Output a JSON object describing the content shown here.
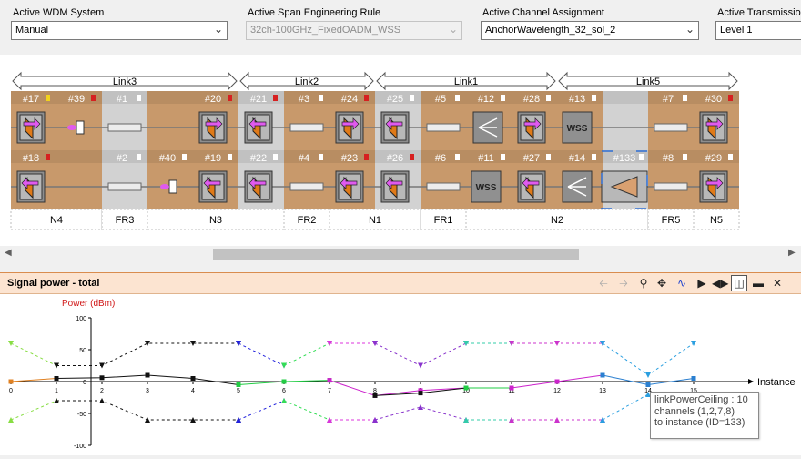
{
  "header": {
    "wdm_system": {
      "label": "Active WDM System",
      "value": "Manual"
    },
    "span_rule": {
      "label": "Active Span Engineering Rule",
      "value": "32ch-100GHz_FixedOADM_WSS"
    },
    "channel_assignment": {
      "label": "Active Channel Assignment",
      "value": "AnchorWavelength_32_sol_2"
    },
    "transmission": {
      "label": "Active Transmissio",
      "value": "Level 1"
    }
  },
  "diagram": {
    "links": [
      "Link3",
      "Link2",
      "Link1",
      "Link5"
    ],
    "row1_labels": [
      "#17",
      "#39",
      "#1",
      "#20",
      "#21",
      "#3",
      "#24",
      "#25",
      "#5",
      "#12",
      "#28",
      "#13",
      "#7",
      "#30"
    ],
    "row2_labels": [
      "#18",
      "#2",
      "#40",
      "#19",
      "#22",
      "#4",
      "#23",
      "#26",
      "#6",
      "#11",
      "#27",
      "#14",
      "#133",
      "#8",
      "#29"
    ],
    "wss_label": "WSS",
    "sites": [
      "N4",
      "FR3",
      "N3",
      "FR2",
      "N1",
      "FR1",
      "N2",
      "FR5",
      "N5"
    ],
    "colors": {
      "site": "#c8996b",
      "fiber": "#d2d2d2",
      "status_red": "#d62020",
      "status_yellow": "#f2d21c",
      "accent": "#e05aef",
      "select": "#2f6fd4"
    }
  },
  "panel": {
    "title": "Signal power - total",
    "tools": [
      "back-arrow",
      "forward-arrow",
      "zoom",
      "pan",
      "trend",
      "step",
      "fit",
      "dock",
      "minimize",
      "close"
    ]
  },
  "chart_data": {
    "type": "line",
    "ylabel": "Power (dBm)",
    "xlabel": "Instance",
    "xlim": [
      0,
      15
    ],
    "ylim": [
      -100,
      100
    ],
    "xticks": [
      0,
      1,
      2,
      3,
      4,
      5,
      6,
      7,
      8,
      9,
      10,
      11,
      12,
      13,
      14,
      15
    ],
    "yticks": [
      -100,
      -50,
      0,
      50,
      100
    ],
    "series": [
      {
        "color": "#e08020",
        "style": "solid",
        "marker": "square",
        "x": [
          0,
          1
        ],
        "y": [
          0,
          5
        ]
      },
      {
        "color": "#111111",
        "style": "solid",
        "marker": "square",
        "x": [
          1,
          2,
          3,
          4,
          5
        ],
        "y": [
          5,
          6,
          10,
          5,
          -5
        ]
      },
      {
        "color": "#22cc44",
        "style": "solid",
        "marker": "square",
        "x": [
          5,
          6,
          7
        ],
        "y": [
          -5,
          0,
          2
        ]
      },
      {
        "color": "#cc22cc",
        "style": "solid",
        "marker": "square",
        "x": [
          7,
          8,
          9,
          10
        ],
        "y": [
          2,
          -22,
          -14,
          -10
        ]
      },
      {
        "color": "#111111",
        "style": "solid",
        "marker": "square",
        "x": [
          8,
          9,
          10,
          11
        ],
        "y": [
          -22,
          -18,
          -10,
          -10
        ]
      },
      {
        "color": "#22cc44",
        "style": "solid",
        "marker": "square",
        "x": [
          10,
          11
        ],
        "y": [
          -10,
          -10
        ]
      },
      {
        "color": "#cc22cc",
        "style": "solid",
        "marker": "square",
        "x": [
          11,
          12,
          13
        ],
        "y": [
          -10,
          0,
          10
        ]
      },
      {
        "color": "#2a7fd0",
        "style": "solid",
        "marker": "square",
        "x": [
          13,
          14,
          15
        ],
        "y": [
          10,
          -5,
          5
        ]
      },
      {
        "color": "#88dd44",
        "style": "dashed",
        "marker": "tri-down",
        "x": [
          0,
          1
        ],
        "y": [
          60,
          25
        ]
      },
      {
        "color": "#111111",
        "style": "dashed",
        "marker": "tri-down",
        "x": [
          1,
          2,
          3,
          4,
          5
        ],
        "y": [
          25,
          25,
          60,
          60,
          60
        ]
      },
      {
        "color": "#2222dd",
        "style": "dashed",
        "marker": "tri-down",
        "x": [
          5,
          6
        ],
        "y": [
          60,
          25
        ]
      },
      {
        "color": "#33dd55",
        "style": "dashed",
        "marker": "tri-down",
        "x": [
          6,
          7
        ],
        "y": [
          25,
          60
        ]
      },
      {
        "color": "#dd33dd",
        "style": "dashed",
        "marker": "tri-down",
        "x": [
          7,
          8
        ],
        "y": [
          60,
          60
        ]
      },
      {
        "color": "#8833cc",
        "style": "dashed",
        "marker": "tri-down",
        "x": [
          8,
          9,
          10
        ],
        "y": [
          60,
          25,
          60
        ]
      },
      {
        "color": "#33ccaa",
        "style": "dashed",
        "marker": "tri-down",
        "x": [
          10,
          11
        ],
        "y": [
          60,
          60
        ]
      },
      {
        "color": "#cc33cc",
        "style": "dashed",
        "marker": "tri-down",
        "x": [
          11,
          12,
          13
        ],
        "y": [
          60,
          60,
          60
        ]
      },
      {
        "color": "#2a9fe0",
        "style": "dashed",
        "marker": "tri-down",
        "x": [
          13,
          14,
          15
        ],
        "y": [
          60,
          10,
          60
        ]
      },
      {
        "color": "#88dd44",
        "style": "dashed",
        "marker": "tri-up",
        "x": [
          0,
          1
        ],
        "y": [
          -60,
          -30
        ]
      },
      {
        "color": "#111111",
        "style": "dashed",
        "marker": "tri-up",
        "x": [
          1,
          2,
          3,
          4,
          5
        ],
        "y": [
          -30,
          -30,
          -60,
          -60,
          -60
        ]
      },
      {
        "color": "#2222dd",
        "style": "dashed",
        "marker": "tri-up",
        "x": [
          5,
          6
        ],
        "y": [
          -60,
          -30
        ]
      },
      {
        "color": "#33dd55",
        "style": "dashed",
        "marker": "tri-up",
        "x": [
          6,
          7
        ],
        "y": [
          -30,
          -60
        ]
      },
      {
        "color": "#dd33dd",
        "style": "dashed",
        "marker": "tri-up",
        "x": [
          7,
          8
        ],
        "y": [
          -60,
          -60
        ]
      },
      {
        "color": "#8833cc",
        "style": "dashed",
        "marker": "tri-up",
        "x": [
          8,
          9,
          10
        ],
        "y": [
          -60,
          -40,
          -60
        ]
      },
      {
        "color": "#33ccaa",
        "style": "dashed",
        "marker": "tri-up",
        "x": [
          10,
          11
        ],
        "y": [
          -60,
          -60
        ]
      },
      {
        "color": "#cc33cc",
        "style": "dashed",
        "marker": "tri-up",
        "x": [
          11,
          12,
          13
        ],
        "y": [
          -60,
          -60,
          -60
        ]
      },
      {
        "color": "#2a9fe0",
        "style": "dashed",
        "marker": "tri-up",
        "x": [
          13,
          14
        ],
        "y": [
          -60,
          -20
        ]
      }
    ]
  },
  "tooltip": {
    "line1": "linkPowerCeiling : 10",
    "line2": "channels (1,2,7,8)",
    "line3": "to instance (ID=133)"
  }
}
